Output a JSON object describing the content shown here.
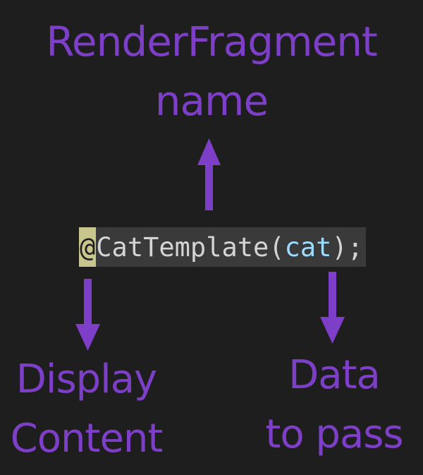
{
  "labels": {
    "top_line1": "RenderFragment",
    "top_line2": "name",
    "left_line1": "Display",
    "left_line2": "Content",
    "right_line1": "Data",
    "right_line2": "to pass"
  },
  "code": {
    "at_sign": "@",
    "name": "CatTemplate",
    "open_paren": "(",
    "param": "cat",
    "close": ");"
  },
  "colors": {
    "background": "#1e1e1e",
    "accent_purple": "#7d3fc8",
    "at_highlight": "#c9c58e",
    "code_highlight": "#3a3a3a",
    "param_blue": "#9cdcfe"
  },
  "icons": [
    "arrow-up-icon",
    "arrow-down-icon",
    "arrow-down-icon"
  ]
}
